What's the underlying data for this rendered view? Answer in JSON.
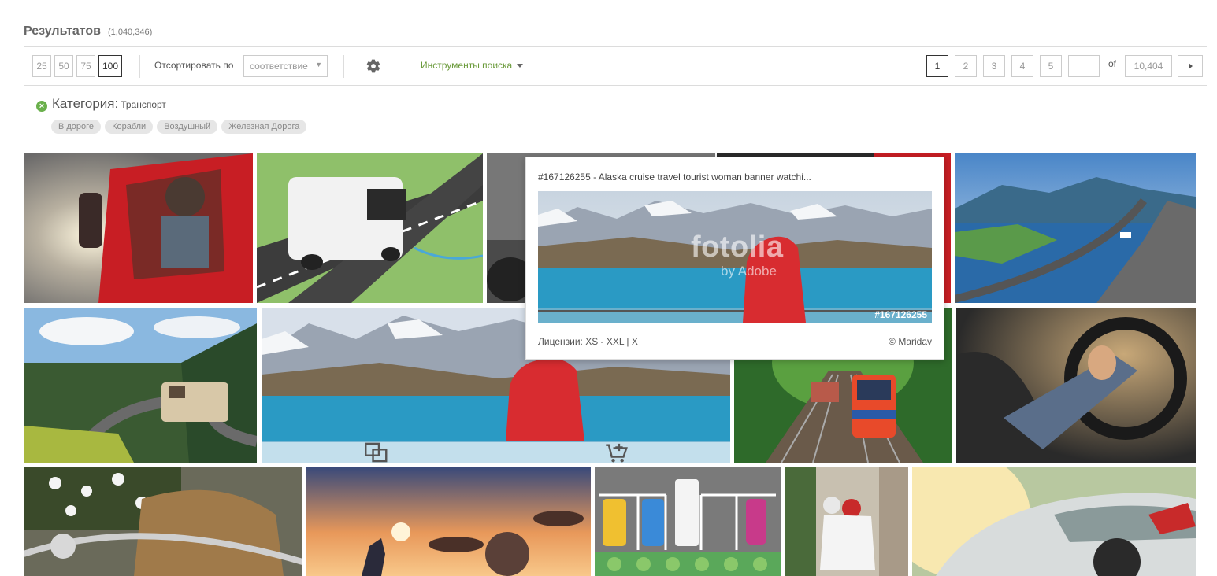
{
  "results": {
    "title": "Результатов",
    "count": "(1,040,346)"
  },
  "toolbar": {
    "per_page": [
      "25",
      "50",
      "75",
      "100"
    ],
    "per_page_selected": "100",
    "sort_label": "Отсортировать по",
    "sort_value": "соответствие",
    "search_tools_label": "Инструменты поиска"
  },
  "pagination": {
    "pages": [
      "1",
      "2",
      "3",
      "4",
      "5"
    ],
    "current": "1",
    "page_input_value": "",
    "of_label": "of",
    "total_pages": "10,404"
  },
  "category_filter": {
    "label": "Категория:",
    "value": "Транспорт",
    "subcategories": [
      "В дороге",
      "Корабли",
      "Воздушный",
      "Железная Дорога"
    ]
  },
  "preview_popup": {
    "title": "#167126255 - Alaska cruise travel tourist woman banner watchi...",
    "watermark_main": "fotolia",
    "watermark_sub": "by Adobe",
    "image_id": "#167126255",
    "licenses": "Лицензии: XS - XXL | X",
    "author": "© Maridav"
  },
  "colors": {
    "accent_green": "#6a9a3a",
    "remove_icon_green": "#6ab04c",
    "chip_bg": "#e6e6e6"
  },
  "icons": [
    "gear-icon",
    "caret-down-icon",
    "next-page-icon",
    "remove-filter-icon",
    "similar-icon",
    "add-to-cart-icon"
  ]
}
